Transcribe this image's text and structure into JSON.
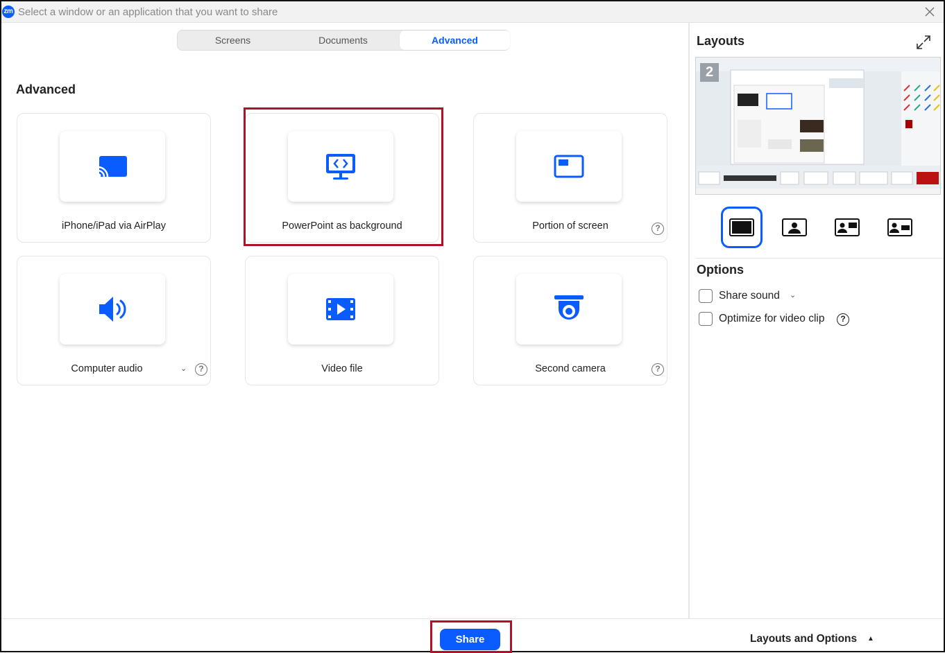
{
  "window": {
    "logo_text": "zm",
    "title": "Select a window or an application that you want to share"
  },
  "tabs": [
    {
      "label": "Screens",
      "active": false
    },
    {
      "label": "Documents",
      "active": false
    },
    {
      "label": "Advanced",
      "active": true
    }
  ],
  "section": {
    "title": "Advanced"
  },
  "cards": [
    {
      "label": "iPhone/iPad via AirPlay",
      "icon": "airplay-icon"
    },
    {
      "label": "PowerPoint as background",
      "icon": "powerpoint-background-icon",
      "highlighted": true
    },
    {
      "label": "Portion of screen",
      "icon": "portion-of-screen-icon",
      "help": "?"
    },
    {
      "label": "Computer audio",
      "icon": "speaker-icon",
      "help": "?",
      "dropdown": "⌄"
    },
    {
      "label": "Video file",
      "icon": "video-file-icon"
    },
    {
      "label": "Second camera",
      "icon": "camera-icon",
      "help": "?"
    }
  ],
  "right_panel": {
    "layouts_title": "Layouts",
    "preview_number": "2",
    "options_title": "Options",
    "options": [
      {
        "label": "Share sound",
        "checked": false,
        "dropdown": "⌄"
      },
      {
        "label": "Optimize for video clip",
        "checked": false,
        "help": "?"
      }
    ]
  },
  "bottom": {
    "share_label": "Share",
    "layouts_options_label": "Layouts and Options",
    "caret": "▲"
  },
  "colors": {
    "accent": "#0b5cff",
    "highlight": "#b0102a"
  }
}
